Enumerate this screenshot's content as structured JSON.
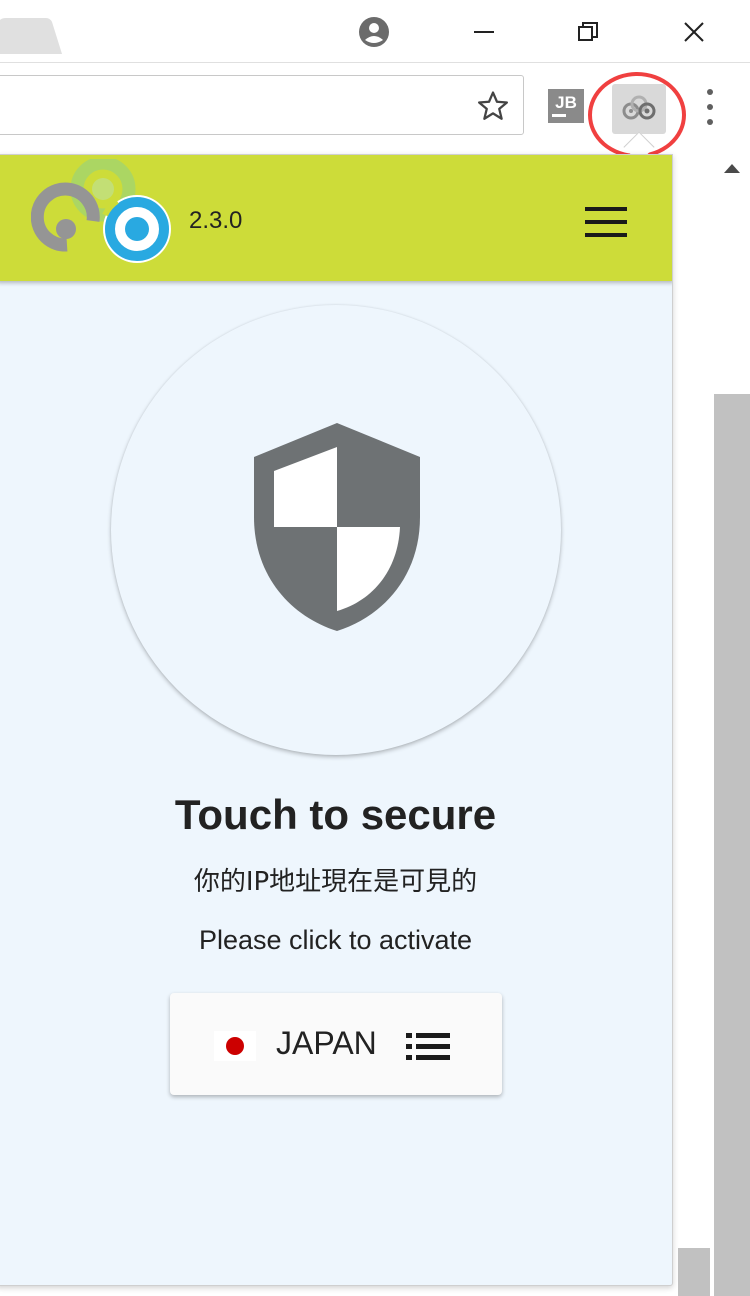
{
  "browser": {
    "window_controls": [
      "profile",
      "minimize",
      "restore",
      "close"
    ]
  },
  "extension": {
    "version": "2.3.0",
    "headline": "Touch to secure",
    "status_text": "你的IP地址現在是可見的",
    "action_text": "Please click to activate",
    "country": {
      "name": "JAPAN",
      "flag": "japan-flag"
    }
  },
  "colors": {
    "header_bg": "#cddc39",
    "popup_bg": "#eef6fd",
    "shield": "#6e7274",
    "highlight_ring": "#f04040",
    "flag_red": "#cc0000"
  }
}
